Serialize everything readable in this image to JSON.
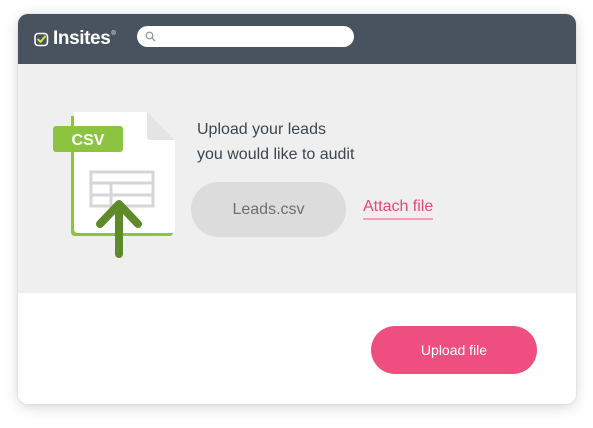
{
  "header": {
    "logo_text": "Insites",
    "logo_registered": "®",
    "search": {
      "value": "",
      "placeholder": ""
    }
  },
  "upload": {
    "file_badge": "CSV",
    "heading_line1": "Upload your leads",
    "heading_line2": "you would like to audit",
    "file_name": "Leads.csv",
    "attach_label": "Attach file"
  },
  "footer": {
    "upload_label": "Upload file"
  },
  "colors": {
    "topbar": "#48535f",
    "content_bg": "#efefef",
    "accent_pink": "#ee4f80",
    "csv_green": "#8cc43f",
    "arrow_green": "#5f8a2a"
  },
  "icons": [
    "insites-logo-icon",
    "search-icon",
    "csv-file-icon",
    "upload-arrow-icon"
  ]
}
